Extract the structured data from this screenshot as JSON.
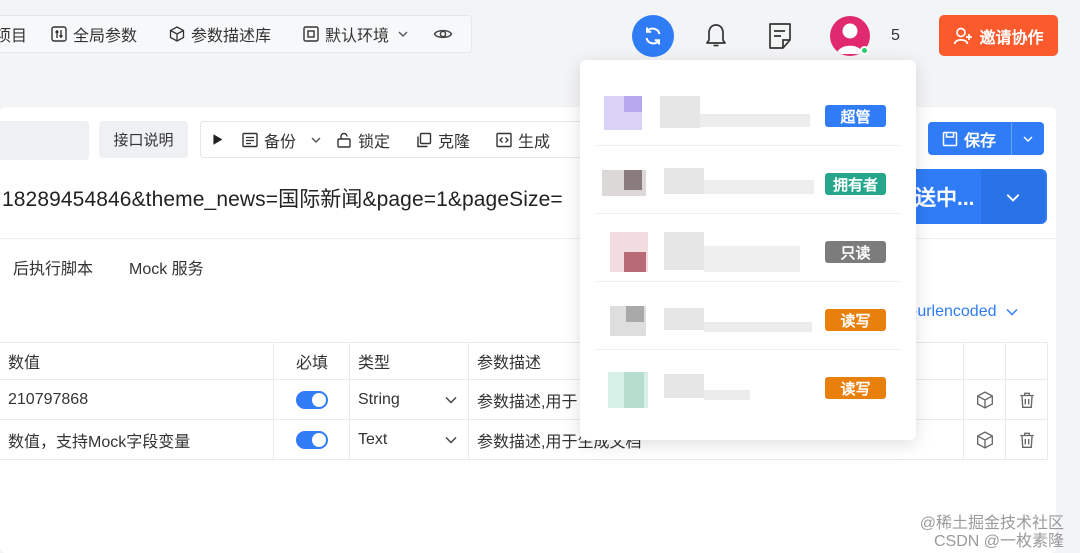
{
  "topnav": {
    "items": [
      {
        "label": "项目",
        "icon": "folder-icon"
      },
      {
        "label": "全局参数",
        "icon": "sliders-icon"
      },
      {
        "label": "参数描述库",
        "icon": "cube-icon"
      },
      {
        "label": "默认环境",
        "icon": "environment-icon"
      }
    ]
  },
  "header": {
    "member_count": "5",
    "invite_label": "邀请协作"
  },
  "toolbar": {
    "api_desc_label": "接口说明",
    "backup_label": "备份",
    "lock_label": "锁定",
    "clone_label": "克隆",
    "generate_label": "生成",
    "save_label": "保存"
  },
  "request": {
    "url": "18289454846&theme_news=国际新闻&page=1&pageSize=",
    "send_label": "送中..."
  },
  "tabs": [
    {
      "label": "后执行脚本"
    },
    {
      "label": "Mock 服务"
    }
  ],
  "body_type": "-urlencoded",
  "table": {
    "headers": [
      "数值",
      "必填",
      "类型",
      "参数描述"
    ],
    "rows": [
      {
        "value": "210797868",
        "required": true,
        "type": "String",
        "desc_placeholder": "参数描述,用于"
      },
      {
        "value_placeholder": "数值，支持Mock字段变量",
        "required": true,
        "type": "Text",
        "desc_placeholder": "参数描述,用于生成文档"
      }
    ]
  },
  "members": [
    {
      "role": "超管",
      "color": "#2f7cf6"
    },
    {
      "role": "拥有者",
      "color": "#26a68a"
    },
    {
      "role": "只读",
      "color": "#7c7c7c"
    },
    {
      "role": "读写",
      "color": "#e8800e"
    },
    {
      "role": "读写",
      "color": "#e8800e"
    }
  ],
  "watermark": {
    "line1": "@稀土掘金技术社区",
    "line2": "CSDN @一枚素隆"
  }
}
